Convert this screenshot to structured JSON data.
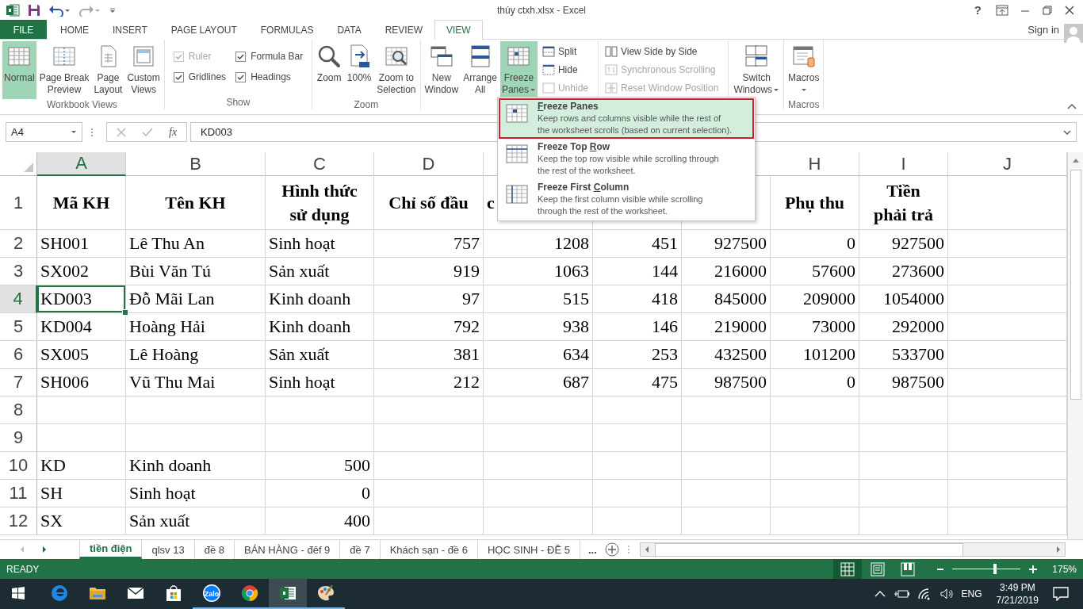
{
  "title_bar": {
    "title": "thúy ctxh.xlsx - Excel",
    "help": "?"
  },
  "ribbon_tabs": [
    {
      "label": "FILE",
      "kind": "file",
      "selected": false
    },
    {
      "label": "HOME",
      "kind": "tab",
      "selected": false
    },
    {
      "label": "INSERT",
      "kind": "tab",
      "selected": false
    },
    {
      "label": "PAGE LAYOUT",
      "kind": "tab",
      "selected": false
    },
    {
      "label": "FORMULAS",
      "kind": "tab",
      "selected": false
    },
    {
      "label": "DATA",
      "kind": "tab",
      "selected": false
    },
    {
      "label": "REVIEW",
      "kind": "tab",
      "selected": false
    },
    {
      "label": "VIEW",
      "kind": "tab",
      "selected": true
    }
  ],
  "account": {
    "label": "Sign in"
  },
  "ribbon_groups": [
    {
      "label": "Workbook Views",
      "items": [
        {
          "kind": "large",
          "label": "Normal",
          "selected": true
        },
        {
          "kind": "large",
          "label": "Page Break\nPreview",
          "selected": false
        },
        {
          "kind": "large",
          "label": "Page\nLayout",
          "selected": false
        },
        {
          "kind": "large",
          "label": "Custom\nViews",
          "selected": false
        }
      ]
    },
    {
      "label": "Show",
      "items": [
        {
          "kind": "checkbox",
          "label": "Ruler",
          "checked": true,
          "disabled": true
        },
        {
          "kind": "checkbox",
          "label": "Formula Bar",
          "checked": true,
          "disabled": false
        },
        {
          "kind": "checkbox",
          "label": "Gridlines",
          "checked": true,
          "disabled": false
        },
        {
          "kind": "checkbox",
          "label": "Headings",
          "checked": true,
          "disabled": false
        }
      ]
    },
    {
      "label": "Zoom",
      "items": [
        {
          "kind": "large",
          "label": "Zoom",
          "selected": false
        },
        {
          "kind": "large",
          "label": "100%",
          "selected": false
        },
        {
          "kind": "large",
          "label": "Zoom to\nSelection",
          "selected": false
        }
      ]
    },
    {
      "items": [
        {
          "kind": "large",
          "label": "New\nWindow",
          "selected": false
        },
        {
          "kind": "large",
          "label": "Arrange\nAll",
          "selected": false
        },
        {
          "kind": "large",
          "label": "Freeze\nPanes",
          "selected": true,
          "dropdown": true
        },
        {
          "kind": "stack",
          "items": [
            {
              "label": "Split",
              "disabled": false
            },
            {
              "label": "Hide",
              "disabled": false
            },
            {
              "label": "Unhide",
              "disabled": true
            }
          ]
        },
        {
          "kind": "stack",
          "items": [
            {
              "label": "View Side by Side",
              "disabled": false
            },
            {
              "label": "Synchronous Scrolling",
              "disabled": true
            },
            {
              "label": "Reset Window Position",
              "disabled": true
            }
          ]
        },
        {
          "kind": "large",
          "label": "Switch\nWindows",
          "selected": false,
          "dropdown": true
        }
      ]
    },
    {
      "label": "Macros",
      "items": [
        {
          "kind": "large",
          "label": "Macros",
          "selected": false,
          "dropdown": true
        }
      ]
    }
  ],
  "formula_bar": {
    "name_box": "A4",
    "function_label": "fx",
    "value": "KD003"
  },
  "grid": {
    "columns": [
      {
        "header": "A",
        "selected": true
      },
      {
        "header": "B",
        "selected": false
      },
      {
        "header": "C",
        "selected": false
      },
      {
        "header": "D",
        "selected": false
      },
      {
        "selected": false
      },
      {
        "selected": false
      },
      {
        "selected": false
      },
      {
        "header": "H",
        "selected": false
      },
      {
        "header": "I",
        "selected": false
      },
      {
        "header": "J",
        "selected": false
      }
    ],
    "rows": [
      {
        "header": "1",
        "selected": false,
        "kind": "heading",
        "cells": [
          "Mã KH",
          "Tên KH",
          "Hình thức\nsử dụng",
          "Chỉ số đầu",
          {
            "text": "c",
            "cut": true
          },
          null,
          null,
          "Phụ thu",
          "Tiền\nphải trả"
        ]
      },
      {
        "header": "2",
        "selected": false,
        "kind": "data",
        "cells": [
          "SH001",
          "Lê Thu An",
          "Sinh hoạt",
          "757",
          "1208",
          "451",
          "927500",
          "0",
          "927500"
        ]
      },
      {
        "header": "3",
        "selected": false,
        "kind": "data",
        "cells": [
          "SX002",
          "Bùi Văn Tú",
          "Sản xuất",
          "919",
          "1063",
          "144",
          "216000",
          "57600",
          "273600"
        ]
      },
      {
        "header": "4",
        "selected": true,
        "kind": "data",
        "cells": [
          "KD003",
          "Đỗ Mãi Lan",
          "Kinh doanh",
          "97",
          "515",
          "418",
          "845000",
          "209000",
          "1054000"
        ]
      },
      {
        "header": "5",
        "selected": false,
        "kind": "data",
        "cells": [
          "KD004",
          "Hoàng Hải",
          "Kinh doanh",
          "792",
          "938",
          "146",
          "219000",
          "73000",
          "292000"
        ]
      },
      {
        "header": "6",
        "selected": false,
        "kind": "data",
        "cells": [
          "SX005",
          "Lê Hoàng",
          "Sản xuất",
          "381",
          "634",
          "253",
          "432500",
          "101200",
          "533700"
        ]
      },
      {
        "header": "7",
        "selected": false,
        "kind": "data",
        "cells": [
          "SH006",
          "Vũ Thu Mai",
          "Sinh hoạt",
          "212",
          "687",
          "475",
          "987500",
          "0",
          "987500"
        ]
      },
      {
        "header": "8",
        "selected": false,
        "kind": "data"
      },
      {
        "header": "9",
        "selected": false,
        "kind": "data"
      },
      {
        "header": "10",
        "selected": false,
        "kind": "data",
        "cells": [
          "KD",
          "Kinh doanh",
          "500"
        ]
      },
      {
        "header": "11",
        "selected": false,
        "kind": "data",
        "cells": [
          "SH",
          "Sinh hoạt",
          "0"
        ]
      },
      {
        "header": "12",
        "selected": false,
        "kind": "data",
        "cells": [
          "SX",
          "Sản xuất",
          "400"
        ]
      }
    ]
  },
  "freeze_menu": {
    "items": [
      {
        "title": {
          "key": "F",
          "after": "reeze Panes"
        },
        "description": "Keep rows and columns visible while the rest of\nthe worksheet scrolls (based on current selection).",
        "selected": true
      },
      {
        "title": {
          "before": "Freeze Top ",
          "key": "R",
          "after": "ow"
        },
        "description": "Keep the top row visible while scrolling through\nthe rest of the worksheet.",
        "selected": false
      },
      {
        "title": {
          "before": "Freeze First ",
          "key": "C",
          "after": "olumn"
        },
        "description": "Keep the first column visible while scrolling\nthrough the rest of the worksheet.",
        "selected": false
      }
    ]
  },
  "sheet_tabs": {
    "tabs": [
      {
        "label": "tiền điện",
        "selected": true
      },
      {
        "label": "qlsv 13",
        "selected": false
      },
      {
        "label": "đề 8",
        "selected": false
      },
      {
        "label": "BÁN HÀNG - đêf 9",
        "selected": false
      },
      {
        "label": "đề 7",
        "selected": false
      },
      {
        "label": "Khách sạn - đề 6",
        "selected": false
      },
      {
        "label": "HỌC SINH - ĐỀ 5",
        "selected": false
      }
    ],
    "more": "..."
  },
  "status_bar": {
    "mode": "READY",
    "views": [
      {
        "selected": true
      },
      {
        "selected": false
      },
      {
        "selected": false
      }
    ],
    "zoom": {
      "level": 0.62
    },
    "zoom_label": "175%"
  },
  "taskbar": {
    "apps": [
      {
        "running": false,
        "active": false
      },
      {
        "running": false,
        "active": false
      },
      {
        "running": false,
        "active": false
      },
      {
        "running": false,
        "active": false
      },
      {
        "running": true,
        "active": false,
        "label": "Zalo"
      },
      {
        "running": true,
        "active": false
      },
      {
        "running": true,
        "active": true
      },
      {
        "running": true,
        "active": false
      }
    ],
    "language": "ENG",
    "time": "3:49 PM",
    "date": "7/21/2019"
  }
}
